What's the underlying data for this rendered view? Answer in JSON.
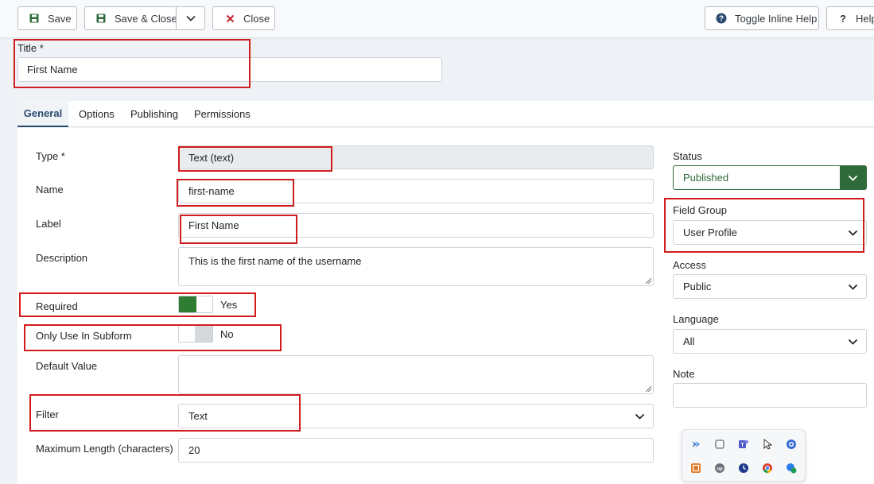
{
  "toolbar": {
    "save": "Save",
    "save_close": "Save & Close",
    "close": "Close",
    "toggle_help": "Toggle Inline Help",
    "help": "Help"
  },
  "title": {
    "label": "Title *",
    "value": "First Name"
  },
  "tabs": [
    {
      "label": "General",
      "active": true
    },
    {
      "label": "Options",
      "active": false
    },
    {
      "label": "Publishing",
      "active": false
    },
    {
      "label": "Permissions",
      "active": false
    }
  ],
  "fields": {
    "type": {
      "label": "Type *",
      "value": "Text (text)"
    },
    "name": {
      "label": "Name",
      "value": "first-name"
    },
    "label": {
      "label": "Label",
      "value": "First Name"
    },
    "description": {
      "label": "Description",
      "value": "This is the first name of the username"
    },
    "required": {
      "label": "Required",
      "value": "Yes",
      "on": true
    },
    "subform": {
      "label": "Only Use In Subform",
      "value": "No",
      "on": false
    },
    "default_value": {
      "label": "Default Value",
      "value": ""
    },
    "filter": {
      "label": "Filter",
      "value": "Text"
    },
    "max_length": {
      "label": "Maximum Length (characters)",
      "value": "20"
    }
  },
  "sidebar": {
    "status": {
      "label": "Status",
      "value": "Published"
    },
    "field_group": {
      "label": "Field Group",
      "value": "User Profile"
    },
    "access": {
      "label": "Access",
      "value": "Public"
    },
    "language": {
      "label": "Language",
      "value": "All"
    },
    "note": {
      "label": "Note",
      "value": ""
    }
  },
  "colors": {
    "accent": "#2a4a70",
    "published_green": "#2f6b3a",
    "toggle_on": "#2f7d32",
    "highlight_red": "#d01c1c"
  },
  "tray_icons": [
    "arrow-icon",
    "window-icon",
    "teams-icon",
    "cursor-icon",
    "vpn-icon",
    "app-icon",
    "up-icon",
    "clock-icon",
    "chrome-icon",
    "shield-icon"
  ]
}
